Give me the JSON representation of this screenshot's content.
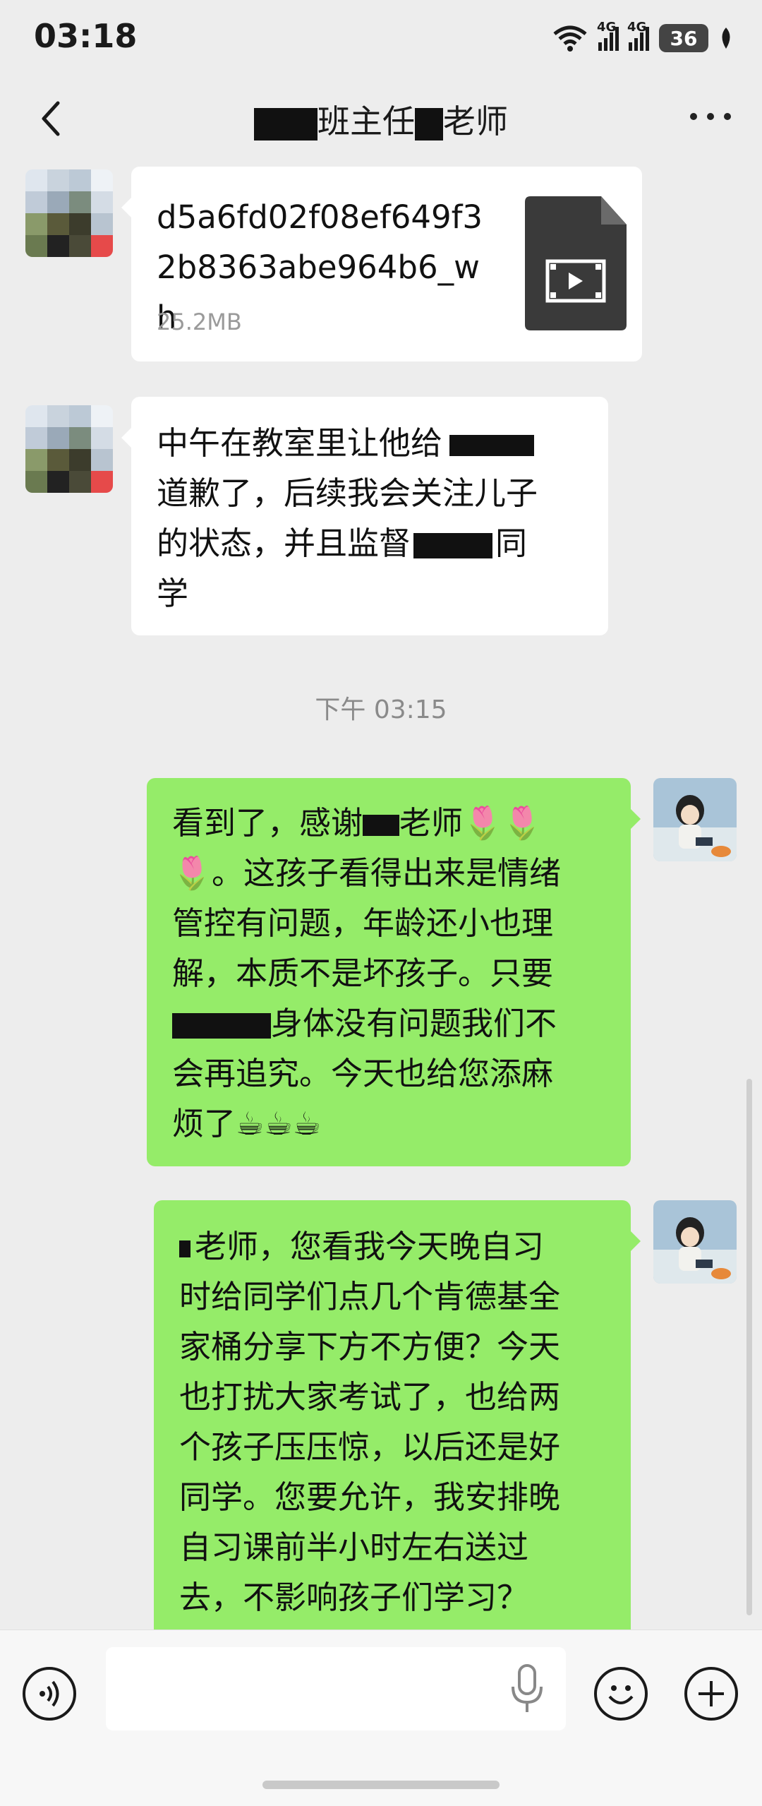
{
  "status_bar": {
    "time": "03:18",
    "network_1": "4G",
    "network_2": "4G",
    "battery": "36",
    "wifi_label": "6"
  },
  "header": {
    "title_1": "班主任",
    "title_2": "老师"
  },
  "messages": {
    "file": {
      "name": "d5a6fd02f08ef649f32b8363abe964b6_wh",
      "size": "25.2MB"
    },
    "text1": {
      "line1": "中午在教室里让他给",
      "line2": "道歉了，后续我会关注儿子",
      "line3a": "的状态，并且监督",
      "line3b": "同",
      "line4": "学"
    },
    "timestamp": "下午 03:15",
    "reply1": {
      "line1a": "看到了，感谢",
      "line1b": "老师",
      "line2": "。这孩子看得出来是情绪",
      "line3": "管控有问题，年龄还小也理",
      "line4": "解，本质不是坏孩子。只要",
      "line5": "身体没有问题我们不",
      "line6": "会再追究。今天也给您添麻",
      "line7": "烦了"
    },
    "reply2": {
      "line1": "老师，您看我今天晚自习",
      "line2": "时给同学们点几个肯德基全",
      "line3": "家桶分享下方不方便？今天",
      "line4": "也打扰大家考试了，也给两",
      "line5": "个孩子压压惊，以后还是好",
      "line6": "同学。您要允许，我安排晚",
      "line7": "自习课前半小时左右送过",
      "line8": "去，不影响孩子们学习？"
    }
  },
  "emoji": {
    "tulip": "🌷",
    "coffee": "☕"
  },
  "input": {
    "placeholder": ""
  },
  "colors": {
    "bubble_green": "#95ec69",
    "background": "#ededed"
  }
}
